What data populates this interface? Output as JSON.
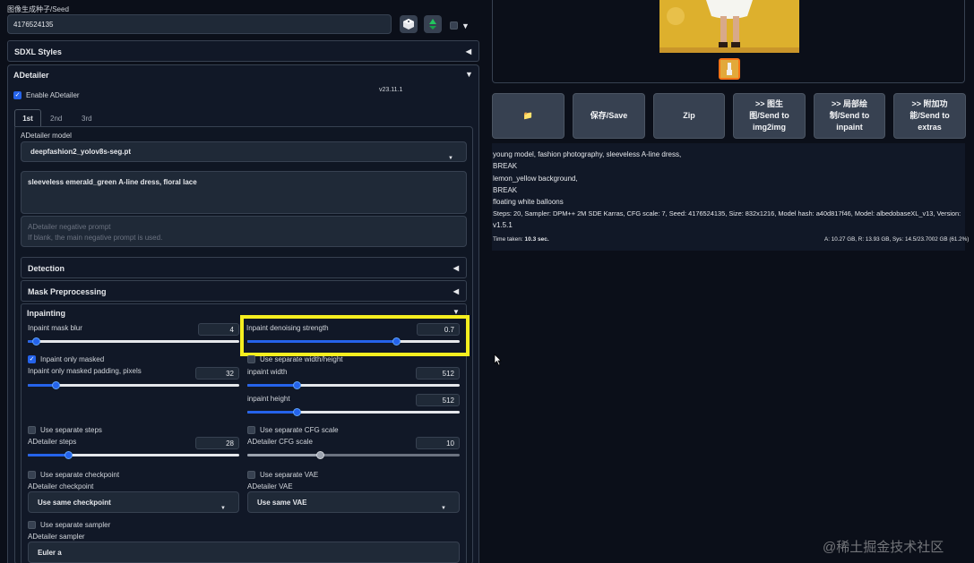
{
  "seed": {
    "label": "图像生成种子/Seed",
    "value": "4176524135"
  },
  "seed_extra": {
    "toggle_caret": "▼"
  },
  "sdxl_styles": {
    "label": "SDXL Styles"
  },
  "adetailer": {
    "label": "ADetailer",
    "enable_label": "Enable ADetailer",
    "version": "v23.11.1",
    "tabs": [
      "1st",
      "2nd",
      "3rd"
    ],
    "model_label": "ADetailer model",
    "model_value": "deepfashion2_yolov8s-seg.pt",
    "prompt_value": "sleeveless emerald_green A-line dress, floral lace",
    "neg_prompt_placeholder_1": "ADetailer negative prompt",
    "neg_prompt_placeholder_2": "If blank, the main negative prompt is used.",
    "detection_label": "Detection",
    "mask_label": "Mask Preprocessing",
    "inpainting_label": "Inpainting",
    "mask_blur": {
      "label": "Inpaint mask blur",
      "value": "4",
      "fraction": 0.04
    },
    "denoise": {
      "label": "Inpaint denoising strength",
      "value": "0.7",
      "fraction": 0.7
    },
    "only_masked_label": "Inpaint only masked",
    "separate_wh_label": "Use separate width/height",
    "padding": {
      "label": "Inpaint only masked padding, pixels",
      "value": "32",
      "fraction": 0.13
    },
    "width": {
      "label": "inpaint width",
      "value": "512",
      "fraction": 0.23
    },
    "height": {
      "label": "inpaint height",
      "value": "512",
      "fraction": 0.23
    },
    "sep_steps_label": "Use separate steps",
    "sep_cfg_label": "Use separate CFG scale",
    "steps": {
      "label": "ADetailer steps",
      "value": "28",
      "fraction": 0.19
    },
    "cfg": {
      "label": "ADetailer CFG scale",
      "value": "10",
      "fraction": 0.34
    },
    "sep_ckpt_label": "Use separate checkpoint",
    "sep_vae_label": "Use separate VAE",
    "ckpt_label": "ADetailer checkpoint",
    "ckpt_value": "Use same checkpoint",
    "vae_label": "ADetailer VAE",
    "vae_value": "Use same VAE",
    "sep_sampler_label": "Use separate sampler",
    "sampler_label": "ADetailer sampler",
    "sampler_value": "Euler a"
  },
  "actions": [
    {
      "name": "open-folder-button",
      "label": "📁"
    },
    {
      "name": "save-button",
      "label": "保存/Save"
    },
    {
      "name": "zip-button",
      "label": "Zip"
    },
    {
      "name": "send-img2img-button",
      "label": ">> 图生\n图/Send to\nimg2img"
    },
    {
      "name": "send-inpaint-button",
      "label": ">> 局部绘\n制/Send to\ninpaint"
    },
    {
      "name": "send-extras-button",
      "label": ">> 附加功\n能/Send to\nextras"
    }
  ],
  "info": {
    "lines": [
      "young model, fashion photography, sleeveless A-line dress,",
      "BREAK",
      "lemon_yellow background,",
      "BREAK",
      "floating white balloons",
      "Steps: 20, Sampler: DPM++ 2M SDE Karras, CFG scale: 7, Seed: 4176524135, Size: 832x1216, Model hash: a40d817f46, Model: albedobaseXL_v13, Version:",
      "v1.5.1"
    ],
    "time_label": "Time taken:",
    "time_value": "10.3 sec.",
    "memory": "A: 10.27 GB, R: 13.93 GB, Sys: 14.5/23.7002 GB (61.2%)"
  },
  "watermark": "@稀土掘金技术社区",
  "colors": {
    "accent": "#2563eb",
    "highlight": "#f5ee1f",
    "background": "#0b0f19"
  }
}
